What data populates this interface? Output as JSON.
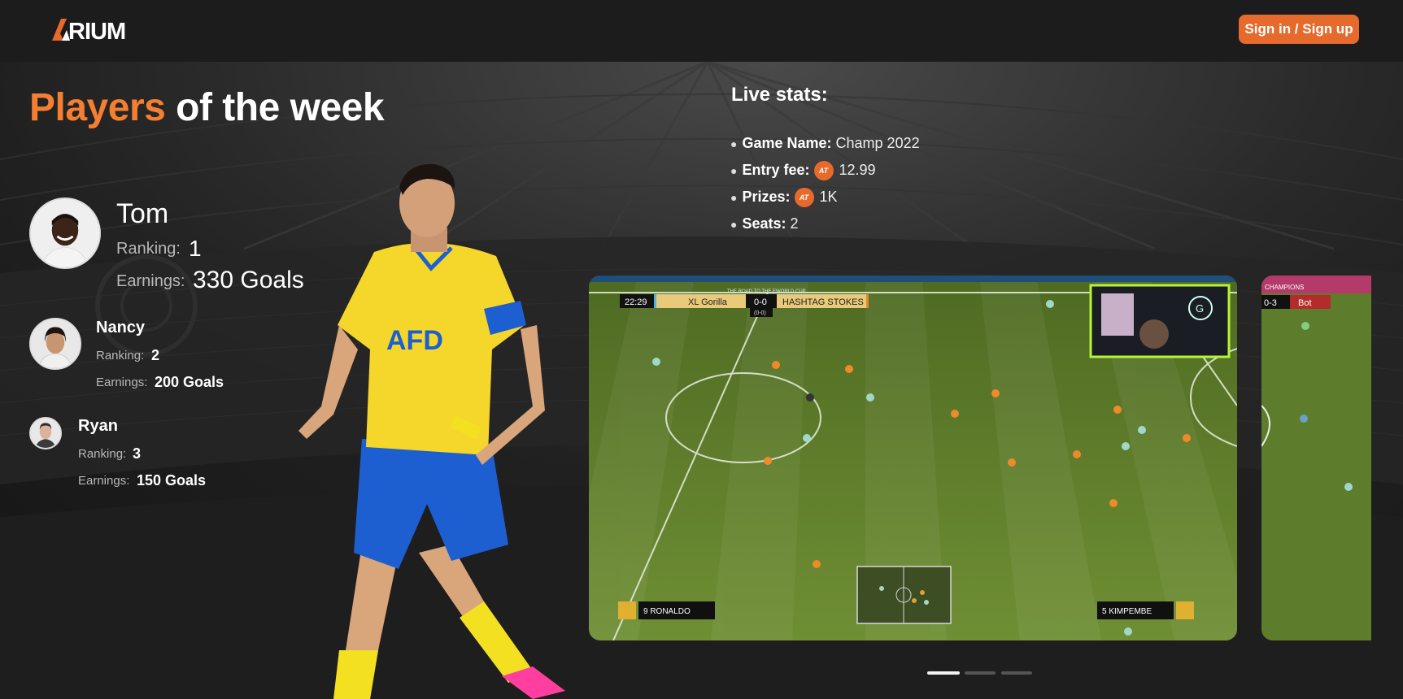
{
  "header": {
    "logo_text": "ARIUM",
    "signin_label": "Sign in / Sign up",
    "accent_color": "#e56a2c"
  },
  "players_of_week": {
    "title_accent": "Players",
    "title_rest": " of the week",
    "players": [
      {
        "name": "Tom",
        "ranking_label": "Ranking:",
        "ranking": "1",
        "earnings_label": "Earnings:",
        "earnings": "330 Goals"
      },
      {
        "name": "Nancy",
        "ranking_label": "Ranking:",
        "ranking": "2",
        "earnings_label": "Earnings:",
        "earnings": "200 Goals"
      },
      {
        "name": "Ryan",
        "ranking_label": "Ranking:",
        "ranking": "3",
        "earnings_label": "Earnings:",
        "earnings": "150 Goals"
      }
    ]
  },
  "live_stats": {
    "title": "Live stats:",
    "items": [
      {
        "key": "Game Name:",
        "value": "Champ 2022"
      },
      {
        "key": "Entry fee:",
        "value": "12.99",
        "icon": "arium-coin-icon"
      },
      {
        "key": "Prizes:",
        "value": "1K",
        "icon": "arium-coin-icon"
      },
      {
        "key": "Seats:",
        "value": "2"
      }
    ]
  },
  "video_1": {
    "banner": "THE ROAD TO THE EWORLD CUP",
    "clock": "22:29",
    "home_team": "XL Gorilla",
    "score": "0-0",
    "aggregate": "(0-0)",
    "away_team": "HASHTAG STOKES",
    "home_player": "9 RONALDO",
    "away_player": "5 KIMPEMBE"
  },
  "video_2": {
    "banner": "CHAMPIONS",
    "score": "0-3",
    "team": "Bot"
  },
  "carousel": {
    "slides": 3,
    "active": 1
  }
}
